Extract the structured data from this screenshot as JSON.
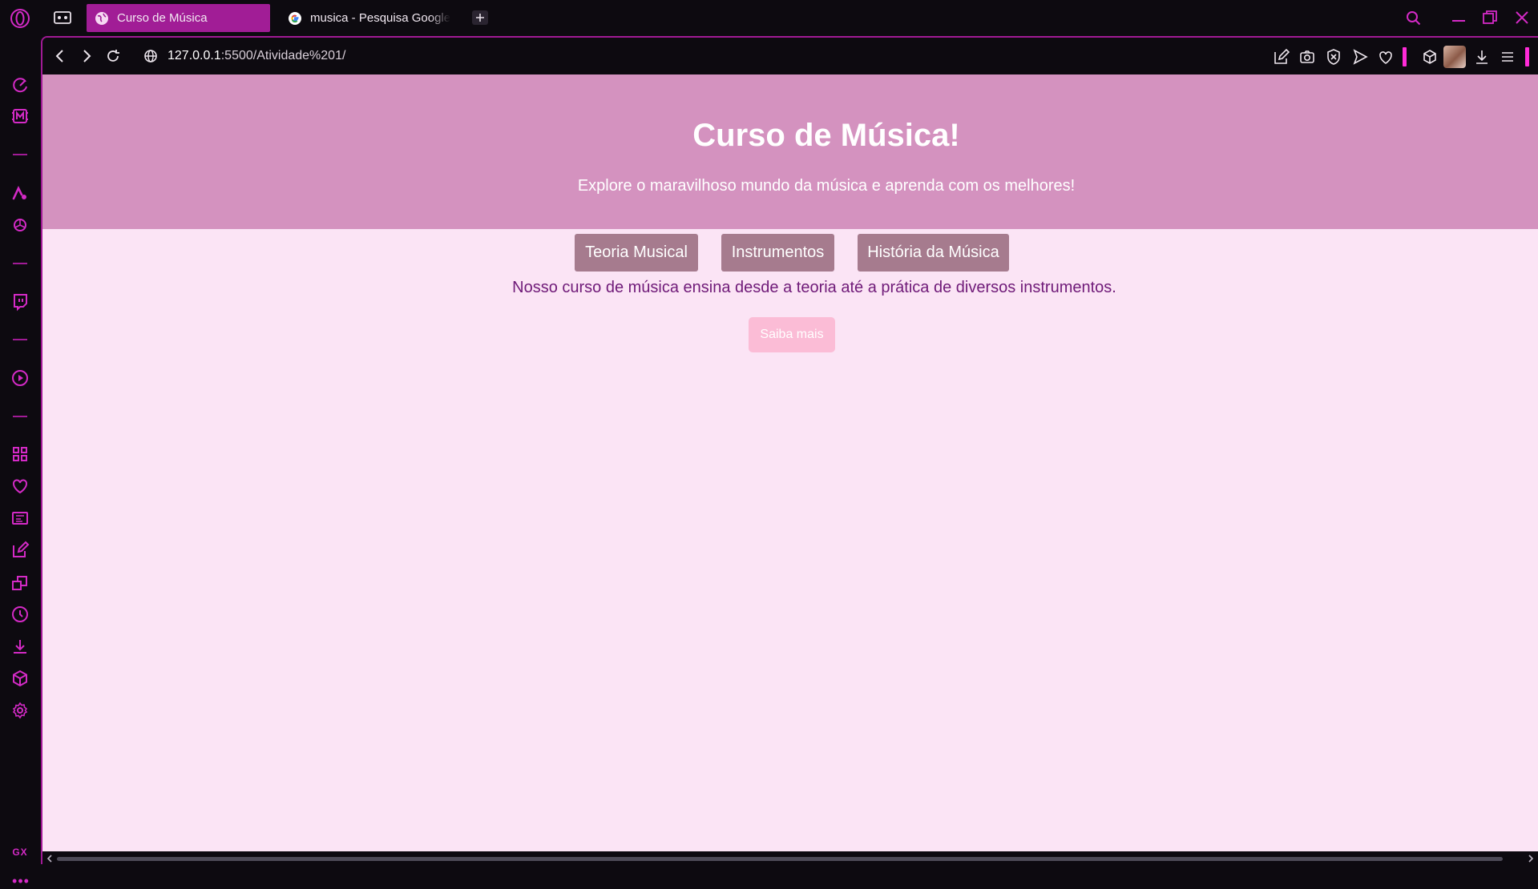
{
  "tabs": [
    {
      "title": "Curso de Música",
      "active": true,
      "favicon": "globe-icon"
    },
    {
      "title": "musica - Pesquisa Google",
      "active": false,
      "favicon": "google-icon"
    }
  ],
  "address": {
    "host": "127.0.0.1",
    "path": ":5500/Atividade%201/"
  },
  "page": {
    "title": "Curso de Música!",
    "subtitle": "Explore o maravilhoso mundo da música e aprenda com os melhores!",
    "nav": [
      "Teoria Musical",
      "Instrumentos",
      "História da Música"
    ],
    "intro": "Nosso curso de música ensina desde a teoria até a prática de diversos instrumentos.",
    "cta": "Saiba mais"
  },
  "sidebar": {
    "gx_label": "GX",
    "more_label": "•••"
  },
  "colors": {
    "accent": "#d42ac6",
    "active_tab": "#a11d96",
    "hero_bg": "#d492bf",
    "page_bg": "#fbe4f5",
    "nav_button": "#a67b8e",
    "intro_text": "#6f1a78",
    "cta_bg": "#fbbcd6"
  }
}
